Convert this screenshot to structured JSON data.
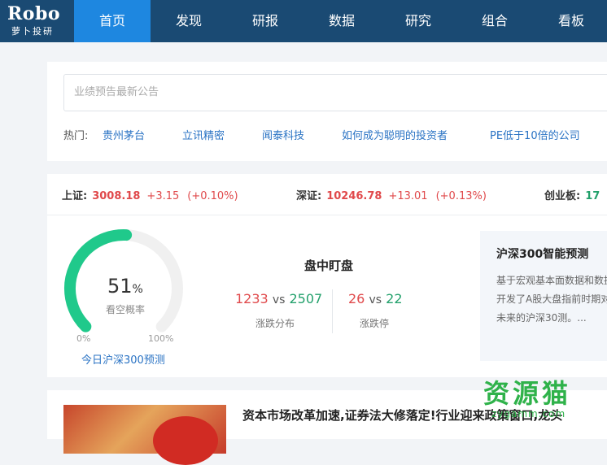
{
  "logo": {
    "main": "Robo",
    "sub": "萝卜投研"
  },
  "nav": [
    {
      "label": "首页",
      "active": true
    },
    {
      "label": "发现"
    },
    {
      "label": "研报"
    },
    {
      "label": "数据"
    },
    {
      "label": "研究"
    },
    {
      "label": "组合"
    },
    {
      "label": "看板"
    }
  ],
  "search": {
    "placeholder": "业绩预告最新公告",
    "hot_label": "热门:",
    "hot": [
      "贵州茅台",
      "立讯精密",
      "闻泰科技",
      "如何成为聪明的投资者",
      "PE低于10倍的公司"
    ]
  },
  "indices": [
    {
      "name": "上证:",
      "value": "3008.18",
      "change": "+3.15",
      "pct": "(+0.10%)"
    },
    {
      "name": "深证:",
      "value": "10246.78",
      "change": "+13.01",
      "pct": "(+0.13%)"
    },
    {
      "name": "创业板:",
      "value": "17"
    }
  ],
  "gauge": {
    "value": "51",
    "unit": "%",
    "fraction": 0.51,
    "label": "看空概率",
    "min_label": "0%",
    "max_label": "100%",
    "link": "今日沪深300预测",
    "colors": {
      "fill": "#20c98b",
      "track": "#f0f0f0"
    }
  },
  "watch": {
    "title": "盘中盯盘",
    "updown": {
      "up": "1233",
      "vs": "vs",
      "down": "2507",
      "label": "涨跌分布"
    },
    "limit": {
      "up": "26",
      "vs": "vs",
      "down": "22",
      "label": "涨跌停"
    }
  },
  "predict": {
    "title": "沪深300智能预测",
    "text": "基于宏观基本面数据和数据开发了A股大盘指前时期对未来的沪深30测。..."
  },
  "news": {
    "title": "资本市场改革加速,证券法大修落定!行业迎来政策窗口,龙头"
  },
  "watermark": {
    "main": "资源猫",
    "sub": "zygamm.com"
  }
}
